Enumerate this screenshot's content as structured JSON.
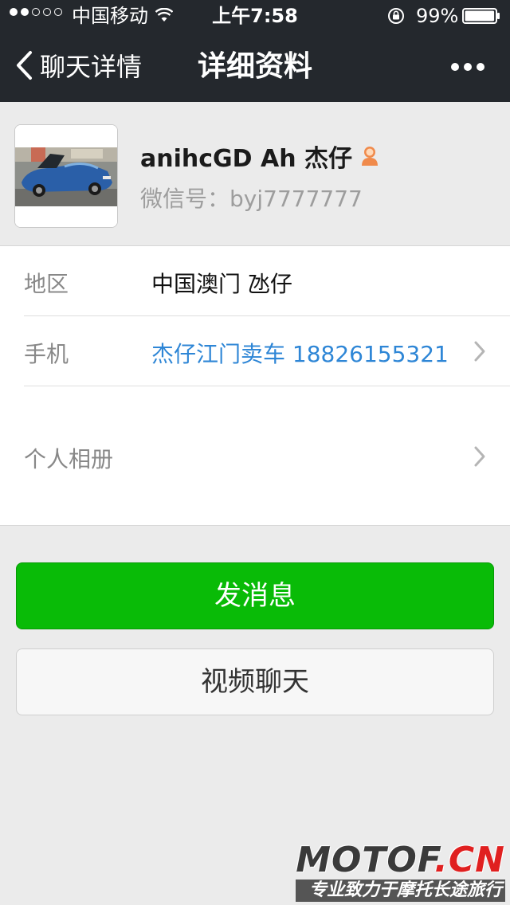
{
  "status_bar": {
    "carrier": "中国移动",
    "time": "上午7:58",
    "battery_percent": "99%",
    "battery_level": 0.99,
    "signal_bars_filled": 2,
    "signal_bars_total": 5
  },
  "nav": {
    "back_label": "聊天详情",
    "title": "详细资料"
  },
  "profile": {
    "name": "anihcGD Ah 杰仔",
    "wechat_id": "微信号：byj7777777"
  },
  "info": {
    "region_label": "地区",
    "region_value": "中国澳门 氹仔",
    "phone_label": "手机",
    "phone_value": "杰仔江门卖车 18826155321",
    "album_label": "个人相册"
  },
  "actions": {
    "message": "发消息",
    "video_call": "视频聊天"
  },
  "watermark": {
    "logo_main": "MOTOF",
    "logo_accent": ".CN",
    "tagline": "专业致力于摩托长途旅行"
  },
  "colors": {
    "nav_bg": "#24282d",
    "primary_green": "#09bb07",
    "link_blue": "#2e86d6"
  }
}
